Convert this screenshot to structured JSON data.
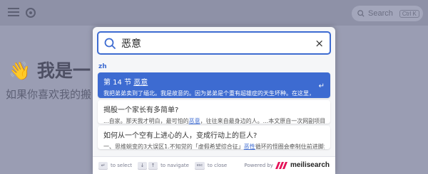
{
  "background": {
    "search_placeholder": "Search",
    "search_shortcut": "Ctrl K",
    "title": "👋 我是一",
    "subtitle": "如果你喜欢我的搬"
  },
  "search": {
    "query": "恶意",
    "close_icon": "×"
  },
  "section_label": "zh",
  "results": [
    {
      "title_prefix": "第 14 节 ",
      "title_match": "恶意",
      "snippet": "我把弟弟卖到了缅北。我是故意的。因为弟弟是个重有超雄症的天生坏种。在这里，没有..."
    },
    {
      "title": "揭股一个家长有多简单?",
      "snippet_pre": "...自家。那天我才明白，最可怕的",
      "snippet_match": "恶意",
      "snippet_post": "，往往来自最身边的人。...本文原自一次网副项目调..."
    },
    {
      "title": "如何从一个空有上进心的人，变成行动上的巨人?",
      "snippet_pre": "一、思维蜕变的3大误区1.不知觉的「虚假希望综合征」",
      "snippet_match": "恶性",
      "snippet_post": "循环的怪圈会牵制住前进脚步..."
    }
  ],
  "footer": {
    "select_label": "to select",
    "navigate_label": "to navigate",
    "close_label": "to close",
    "esc_key": "esc",
    "powered_by": "Powered by",
    "brand": "meilisearch"
  },
  "colors": {
    "accent": "#3d6bd1",
    "brand": "#e41359"
  }
}
